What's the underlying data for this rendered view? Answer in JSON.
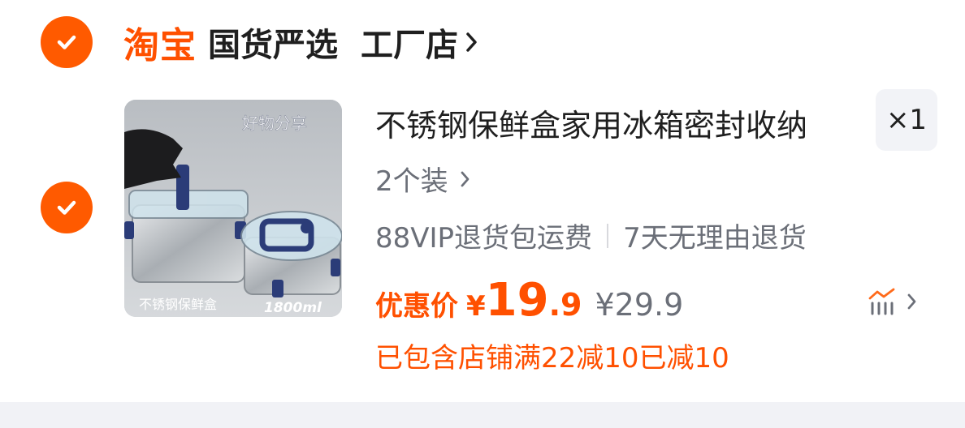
{
  "shop": {
    "logo": "淘宝",
    "name": "国货严选",
    "sub": "工厂店"
  },
  "item": {
    "image_overlay_top": "好物分享",
    "image_overlay_bottom_left": "不锈钢保鲜盒",
    "image_overlay_bottom_right": "1800ml",
    "title": "不锈钢保鲜盒家用冰箱密封收纳",
    "quantity": "×1",
    "spec": "2个装",
    "service_1": "88VIP退货包运费",
    "service_2": "7天无理由退货",
    "price_label": "优惠价",
    "price_symbol": "¥",
    "price_int": "19",
    "price_dec": ".9",
    "original_price": "¥29.9",
    "promo": "已包含店铺满22减10已减10"
  },
  "colors": {
    "accent": "#ff5000",
    "check": "#ff5a00",
    "muted_text": "#6b6f78",
    "page_bg": "#f1f2f6"
  },
  "icons": [
    "check-icon",
    "chevron-right-icon",
    "price-trend-icon"
  ]
}
